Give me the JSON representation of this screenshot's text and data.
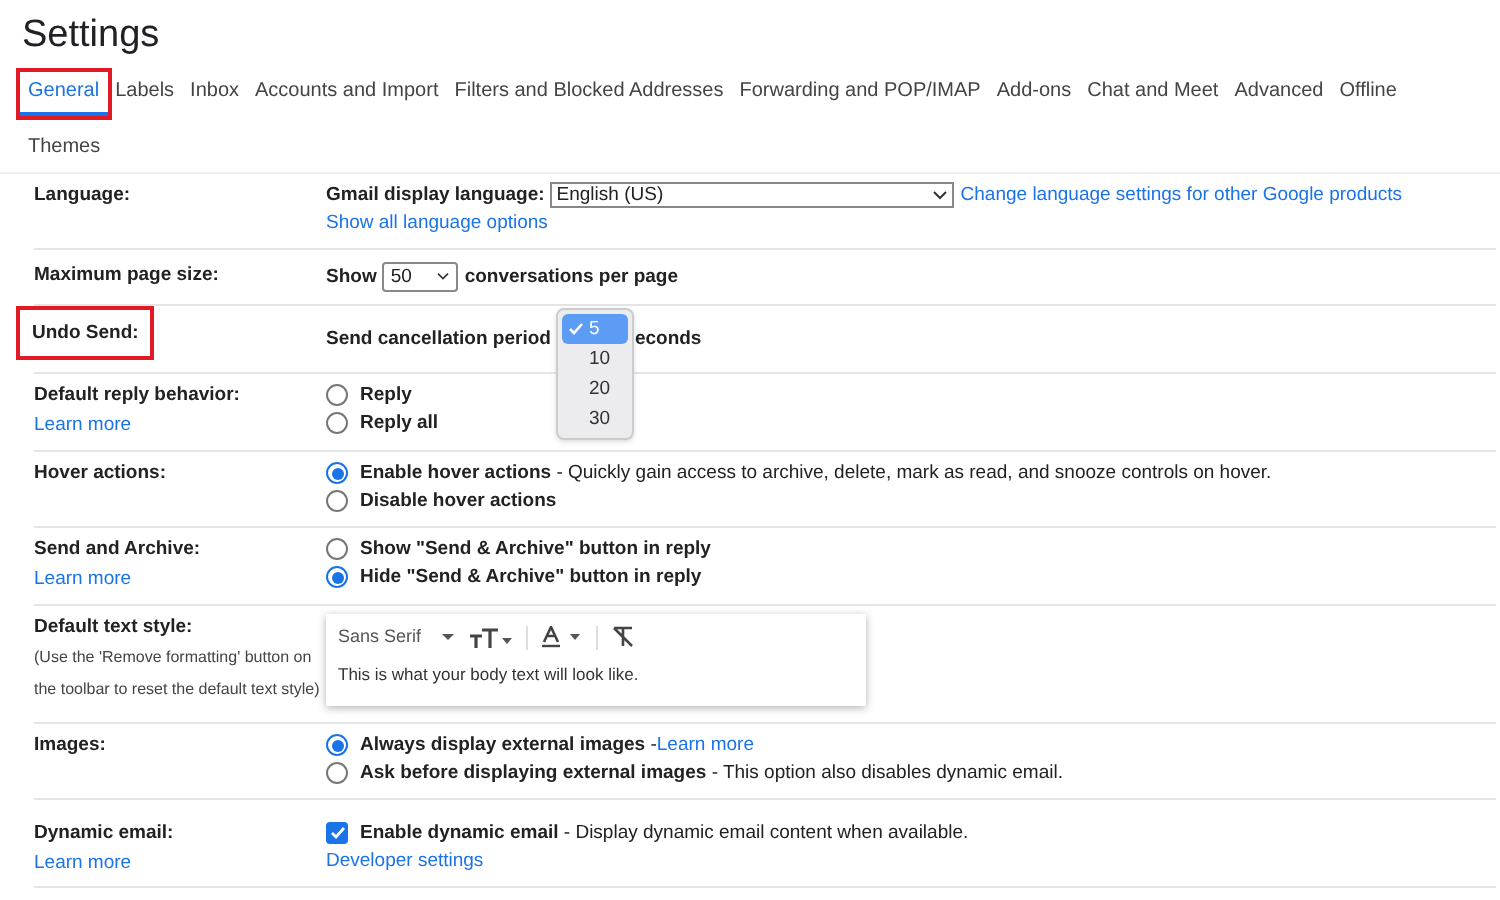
{
  "title": "Settings",
  "tabs": [
    {
      "label": "General",
      "selected": true,
      "highlighted": true
    },
    {
      "label": "Labels",
      "selected": false,
      "highlighted": false
    },
    {
      "label": "Inbox",
      "selected": false,
      "highlighted": false
    },
    {
      "label": "Accounts and Import",
      "selected": false,
      "highlighted": false
    },
    {
      "label": "Filters and Blocked Addresses",
      "selected": false,
      "highlighted": false
    },
    {
      "label": "Forwarding and POP/IMAP",
      "selected": false,
      "highlighted": false
    },
    {
      "label": "Add-ons",
      "selected": false,
      "highlighted": false
    },
    {
      "label": "Chat and Meet",
      "selected": false,
      "highlighted": false
    },
    {
      "label": "Advanced",
      "selected": false,
      "highlighted": false
    },
    {
      "label": "Offline",
      "selected": false,
      "highlighted": false
    },
    {
      "label": "Themes",
      "selected": false,
      "highlighted": false
    }
  ],
  "rows": [
    {
      "kind": "language",
      "label": "Language:",
      "highlighted": false,
      "prefix": "Gmail display language:",
      "value": "English (US)",
      "link": "Change language settings for other Google products",
      "sublink": "Show all language options"
    },
    {
      "kind": "select",
      "label": "Maximum page size:",
      "highlighted": false,
      "prefix": "Show",
      "value": "50",
      "suffix": "conversations per page"
    },
    {
      "kind": "dropdown",
      "label": "Undo Send:",
      "highlighted": true,
      "prefix": "Send cancellation period",
      "suffix": "econds",
      "options": [
        {
          "label": "5",
          "selected": true
        },
        {
          "label": "10",
          "selected": false
        },
        {
          "label": "20",
          "selected": false
        },
        {
          "label": "30",
          "selected": false
        }
      ]
    },
    {
      "kind": "radio",
      "label": "Default reply behavior:",
      "label_link": "Learn more",
      "highlighted": false,
      "options": [
        {
          "label": "Reply",
          "selected": false
        },
        {
          "label": "Reply all",
          "selected": false
        }
      ]
    },
    {
      "kind": "radio",
      "label": "Hover actions:",
      "highlighted": false,
      "options": [
        {
          "label": "Enable hover actions",
          "description": " - Quickly gain access to archive, delete, mark as read, and snooze controls on hover.",
          "selected": true
        },
        {
          "label": "Disable hover actions",
          "selected": false
        }
      ]
    },
    {
      "kind": "radio",
      "label": "Send and Archive:",
      "label_link": "Learn more",
      "highlighted": false,
      "options": [
        {
          "label": "Show \"Send & Archive\" button in reply",
          "selected": false
        },
        {
          "label": "Hide \"Send & Archive\" button in reply",
          "selected": true
        }
      ]
    },
    {
      "kind": "text_style",
      "label": "Default text style:",
      "note": "(Use the 'Remove formatting' button on the toolbar to reset the default text style)",
      "highlighted": false,
      "font": "Sans Serif",
      "sample": "This is what your body text will look like."
    },
    {
      "kind": "radio",
      "label": "Images:",
      "highlighted": false,
      "options": [
        {
          "label": "Always display external images",
          "description": " - ",
          "link": "Learn more",
          "selected": true
        },
        {
          "label": "Ask before displaying external images",
          "description": " - This option also disables dynamic email.",
          "selected": false
        }
      ]
    },
    {
      "kind": "checkbox",
      "label": "Dynamic email:",
      "label_link": "Learn more",
      "highlighted": false,
      "checked": true,
      "option": "Enable dynamic email",
      "description": " - Display dynamic email content when available.",
      "sublink": "Developer settings"
    }
  ]
}
